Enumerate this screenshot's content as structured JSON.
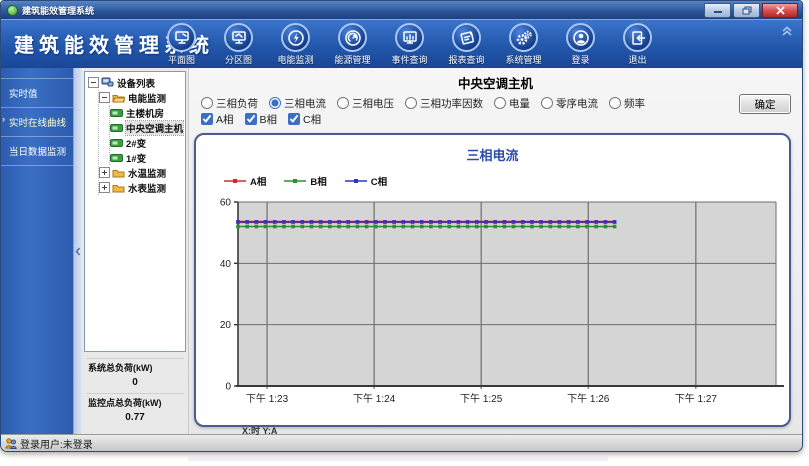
{
  "window": {
    "title": "建筑能效管理系统"
  },
  "header": {
    "app_title": "建筑能效管理系统",
    "nav_items": [
      {
        "label": "平面图",
        "icon": "floorplan-monitor-icon"
      },
      {
        "label": "分区图",
        "icon": "zone-monitor-icon"
      },
      {
        "label": "电能监测",
        "icon": "power-bolt-icon"
      },
      {
        "label": "能源管理",
        "icon": "energy-gauge-icon"
      },
      {
        "label": "事件查询",
        "icon": "event-monitor-icon"
      },
      {
        "label": "报表查询",
        "icon": "report-pencil-icon"
      },
      {
        "label": "系统管理",
        "icon": "gears-icon"
      },
      {
        "label": "登录",
        "icon": "user-icon"
      },
      {
        "label": "退出",
        "icon": "exit-door-icon"
      }
    ]
  },
  "sidebar": {
    "items": [
      {
        "label": "实时值",
        "active": false
      },
      {
        "label": "实时在线曲线",
        "active": true
      },
      {
        "label": "当日数据监测",
        "active": false
      }
    ]
  },
  "tree": {
    "root_label": "设备列表",
    "power_group": {
      "label": "电能监测",
      "children": [
        {
          "label": "主楼机房",
          "selected": false
        },
        {
          "label": "中央空调主机",
          "selected": true
        },
        {
          "label": "2#变",
          "selected": false
        },
        {
          "label": "1#变",
          "selected": false
        }
      ]
    },
    "water_temp_label": "水温监测",
    "water_meter_label": "水表监测"
  },
  "loads": {
    "system_total_label": "系统总负荷(kW)",
    "system_total_value": "0",
    "monitor_total_label": "监控点总负荷(kW)",
    "monitor_total_value": "0.77"
  },
  "main": {
    "page_title": "中央空调主机",
    "radios": [
      {
        "label": "三相负荷",
        "selected": false
      },
      {
        "label": "三相电流",
        "selected": true
      },
      {
        "label": "三相电压",
        "selected": false
      },
      {
        "label": "三相功率因数",
        "selected": false
      },
      {
        "label": "电量",
        "selected": false
      },
      {
        "label": "零序电流",
        "selected": false
      },
      {
        "label": "频率",
        "selected": false
      }
    ],
    "checkboxes": [
      {
        "label": "A相",
        "checked": true
      },
      {
        "label": "B相",
        "checked": true
      },
      {
        "label": "C相",
        "checked": true
      }
    ],
    "confirm_button": "确定"
  },
  "chart_data": {
    "type": "line",
    "title": "三相电流",
    "axis_note": "X:时 Y:A",
    "ylim": [
      0,
      60
    ],
    "y_ticks": [
      0,
      20,
      40,
      60
    ],
    "x_tick_labels": [
      "下午 1:23",
      "下午 1:24",
      "下午 1:25",
      "下午 1:26",
      "下午 1:27"
    ],
    "x_tick_fracs": [
      0.054,
      0.253,
      0.452,
      0.651,
      0.851
    ],
    "data_span_frac": [
      0.0,
      0.7
    ],
    "points_per_series": 42,
    "series": [
      {
        "name": "A相",
        "color": "#cc2b2b",
        "value": 53.5
      },
      {
        "name": "B相",
        "color": "#2e8f2e",
        "value": 52.0
      },
      {
        "name": "C相",
        "color": "#2f35c4",
        "value": 53.5
      }
    ],
    "grid": true,
    "legend_position": "top-left",
    "plot_bg": "#d5d5d5",
    "title_color": "#2a4cae"
  },
  "status_bar": {
    "text": "登录用户:未登录"
  }
}
